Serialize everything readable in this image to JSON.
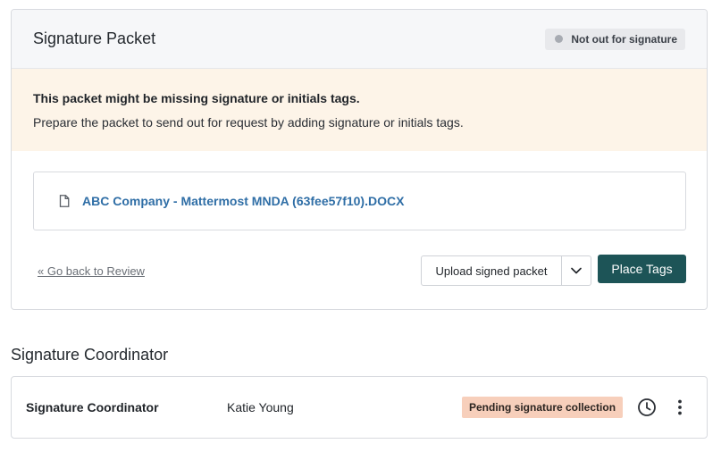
{
  "packet": {
    "title": "Signature Packet",
    "status": "Not out for signature",
    "warning_title": "This packet might be missing signature or initials tags.",
    "warning_text": "Prepare the packet to send out for request by adding signature or initials tags.",
    "document": {
      "icon": "document-icon",
      "name": "ABC Company - Mattermost MNDA (63fee57f10).DOCX"
    },
    "back_link": "« Go back to Review",
    "upload_label": "Upload signed packet",
    "place_tags_label": "Place Tags"
  },
  "coordinator_section": {
    "heading": "Signature Coordinator",
    "role": "Signature Coordinator",
    "name": "Katie Young",
    "status": "Pending signature collection"
  },
  "colors": {
    "primary_button": "#1d5457",
    "link": "#2f6ea6",
    "warning_bg": "#fdf4e8",
    "pending_badge": "#f7cfbb",
    "status_pill": "#e8e9ec"
  }
}
